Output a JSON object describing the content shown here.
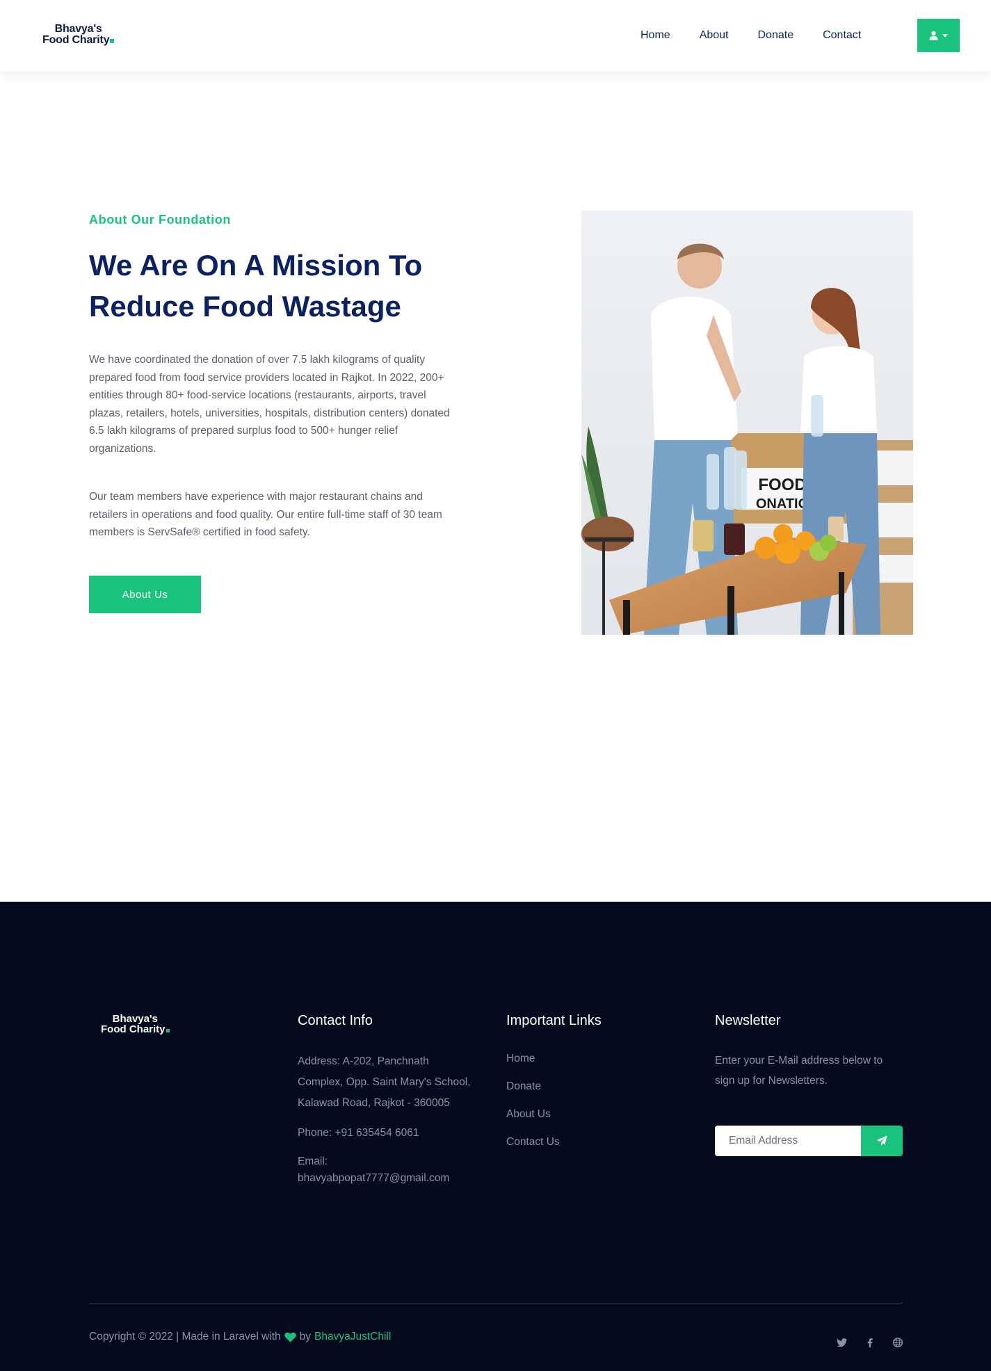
{
  "brand": {
    "name_line1": "Bhavya's",
    "name_line2": "Food Charity",
    "accent_color": "#19c37d",
    "navy_color": "#0b2162"
  },
  "nav": {
    "items": [
      "Home",
      "About",
      "Donate",
      "Contact"
    ],
    "user_menu_icon": "user-icon"
  },
  "about": {
    "eyebrow": "About Our Foundation",
    "headline": "We Are On A Mission To Reduce Food Wastage",
    "paragraph1": "We have coordinated the donation of over 7.5 lakh kilograms of quality prepared food from food service providers located in Rajkot. In 2022, 200+ entities through 80+ food-service locations (restaurants, airports, travel plazas, retailers, hotels, universities, hospitals, distribution centers) donated 6.5 lakh kilograms of prepared surplus food to 500+ hunger relief organizations.",
    "paragraph2": "Our team members have experience with major restaurant chains and retailers in operations and food quality. Our entire full-time staff of 30 team members is ServSafe® certified in food safety.",
    "button_label": "About Us",
    "photo_box_text_1": "FOOD",
    "photo_box_text_2": "ONATIO"
  },
  "footer": {
    "logo_line1": "Bhavya's",
    "logo_line2": "Food Charity",
    "contact": {
      "title": "Contact Info",
      "address_line1": "Address: A-202, Panchnath",
      "address_line2": "Complex, Opp. Saint Mary's School,",
      "address_line3": "Kalawad Road, Rajkot - 360005",
      "phone": "Phone: +91 635454 6061",
      "email_label": "Email:",
      "email": "bhavyabpopat7777@gmail.com"
    },
    "links": {
      "title": "Important Links",
      "items": [
        "Home",
        "Donate",
        "About Us",
        "Contact Us"
      ]
    },
    "newsletter": {
      "title": "Newsletter",
      "line1": "Enter your E-Mail address below to",
      "line2": "sign up for Newsletters.",
      "placeholder": "Email Address",
      "send_icon": "paper-plane-icon"
    },
    "copyright_prefix": "Copyright © 2022 | Made in Laravel with",
    "copyright_by": "by",
    "copyright_author": "BhavyaJustChill",
    "social_icons": [
      "twitter-icon",
      "facebook-icon",
      "globe-icon"
    ]
  }
}
